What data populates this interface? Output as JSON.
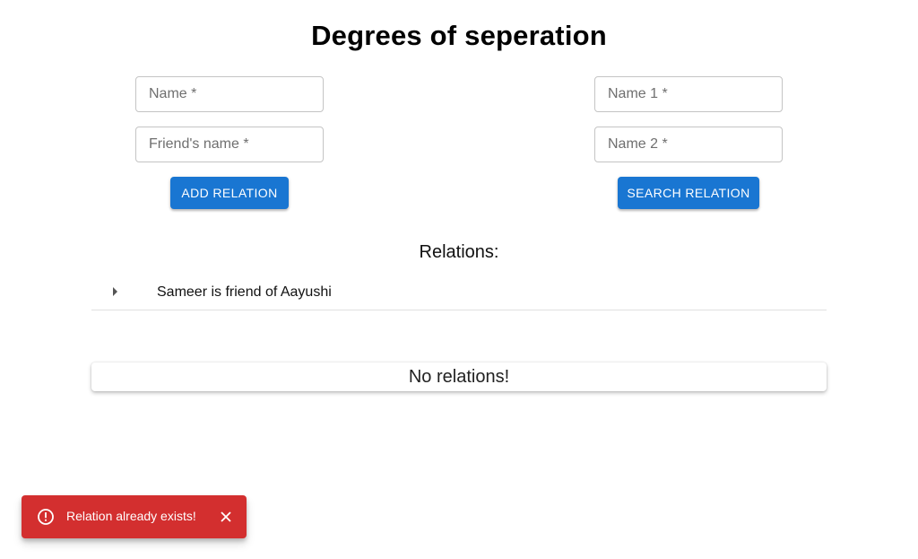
{
  "app": {
    "title": "Degrees of seperation"
  },
  "add_form": {
    "name_placeholder": "Name *",
    "friend_placeholder": "Friend's name *",
    "button_label": "Add relation"
  },
  "search_form": {
    "name1_placeholder": "Name 1 *",
    "name2_placeholder": "Name 2 *",
    "button_label": "Search relation"
  },
  "relations": {
    "heading": "Relations:",
    "items": [
      {
        "text": "Sameer is friend of Aayushi",
        "icon": "caret-right-icon"
      }
    ]
  },
  "search_result": {
    "text": "No relations!"
  },
  "toast": {
    "message": "Relation already exists!",
    "icon": "error-outline-icon",
    "close_icon": "close-icon",
    "color": "#d32f2f"
  },
  "colors": {
    "primary": "#1976d2",
    "error": "#d32f2f"
  }
}
